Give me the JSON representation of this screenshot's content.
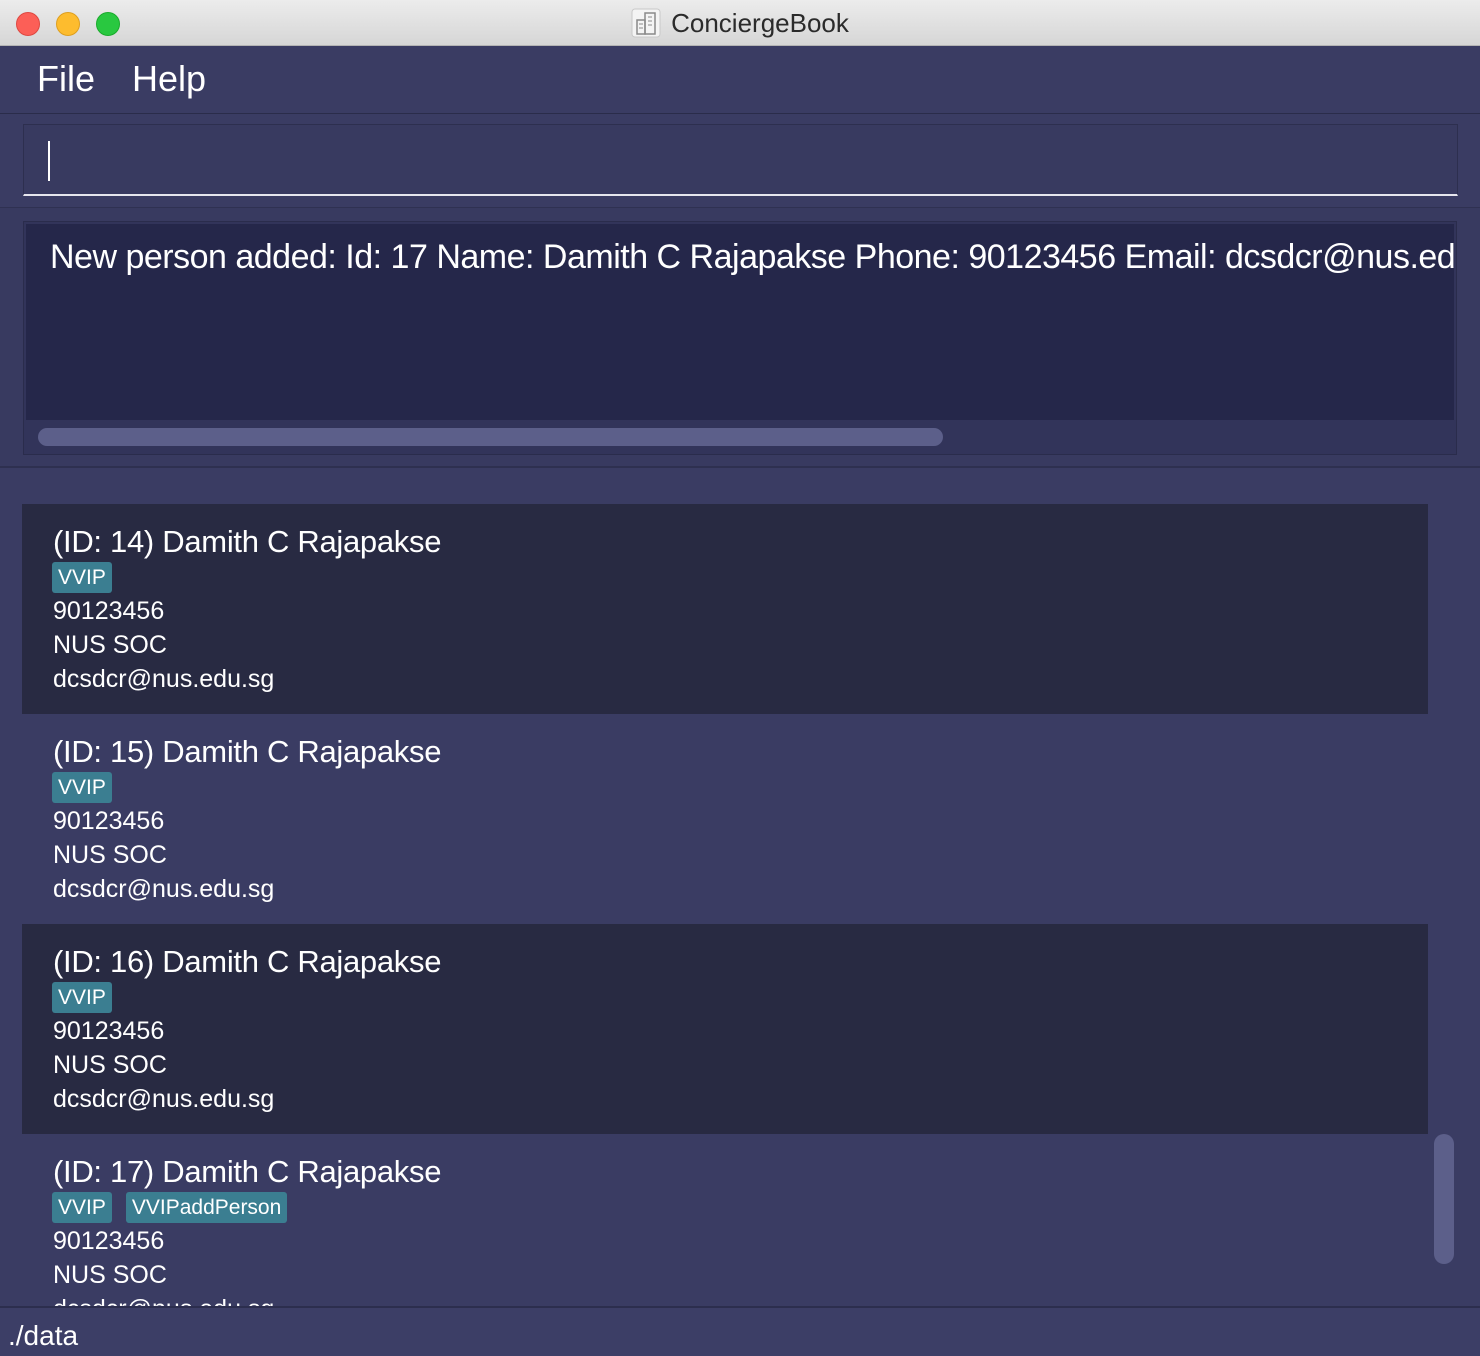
{
  "window": {
    "title": "ConciergeBook",
    "app_icon": "building-icon"
  },
  "menu": {
    "file_label": "File",
    "help_label": "Help"
  },
  "command_box": {
    "value": ""
  },
  "result_display": {
    "text": "New person added: Id: 17 Name: Damith C Rajapakse Phone: 90123456 Email: dcsdcr@nus.edu.sg"
  },
  "persons": [
    {
      "header": "(ID: 14) Damith C Rajapakse",
      "tags": [
        "VVIP"
      ],
      "phone": "90123456",
      "address": "NUS SOC",
      "email": "dcsdcr@nus.edu.sg"
    },
    {
      "header": "(ID: 15) Damith C Rajapakse",
      "tags": [
        "VVIP"
      ],
      "phone": "90123456",
      "address": "NUS SOC",
      "email": "dcsdcr@nus.edu.sg"
    },
    {
      "header": "(ID: 16) Damith C Rajapakse",
      "tags": [
        "VVIP"
      ],
      "phone": "90123456",
      "address": "NUS SOC",
      "email": "dcsdcr@nus.edu.sg"
    },
    {
      "header": "(ID: 17) Damith C Rajapakse",
      "tags": [
        "VVIP",
        "VVIPaddPerson"
      ],
      "phone": "90123456",
      "address": "NUS SOC",
      "email": "dcsdcr@nus.edu.sg"
    }
  ],
  "status_bar": {
    "path": "./data"
  },
  "colors": {
    "background": "#3a3c63",
    "card_dark": "#282a42",
    "tag": "#3b7e91",
    "result_bg": "#25274a"
  }
}
